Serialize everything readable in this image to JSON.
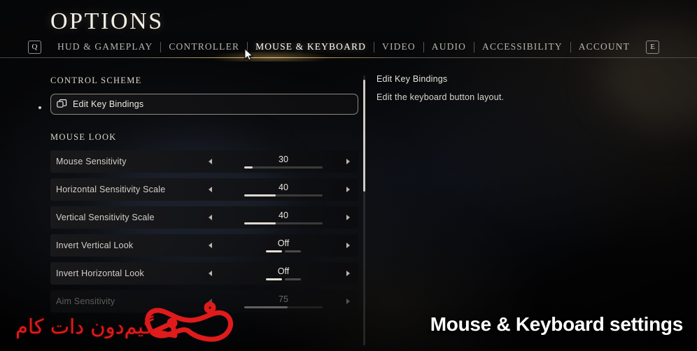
{
  "header": {
    "title": "OPTIONS",
    "left_key_hint": "Q",
    "right_key_hint": "E",
    "tabs": [
      {
        "label": "HUD & GAMEPLAY",
        "active": false
      },
      {
        "label": "CONTROLLER",
        "active": false
      },
      {
        "label": "MOUSE & KEYBOARD",
        "active": true
      },
      {
        "label": "VIDEO",
        "active": false
      },
      {
        "label": "AUDIO",
        "active": false
      },
      {
        "label": "ACCESSIBILITY",
        "active": false
      },
      {
        "label": "ACCOUNT",
        "active": false
      }
    ]
  },
  "sections": [
    {
      "heading": "CONTROL SCHEME",
      "rows": [
        {
          "label": "Edit Key Bindings",
          "type": "action",
          "icon": "key-bindings-icon",
          "selected": true
        }
      ]
    },
    {
      "heading": "MOUSE LOOK",
      "rows": [
        {
          "label": "Mouse Sensitivity",
          "type": "slider",
          "value": "30",
          "fill_percent": 11
        },
        {
          "label": "Horizontal Sensitivity Scale",
          "type": "slider",
          "value": "40",
          "fill_percent": 40
        },
        {
          "label": "Vertical Sensitivity Scale",
          "type": "slider",
          "value": "40",
          "fill_percent": 40
        },
        {
          "label": "Invert Vertical Look",
          "type": "toggle",
          "value": "Off",
          "on_index": 0
        },
        {
          "label": "Invert Horizontal Look",
          "type": "toggle",
          "value": "Off",
          "on_index": 0
        },
        {
          "label": "Aim Sensitivity",
          "type": "slider",
          "value": "75",
          "fill_percent": 55,
          "faded": true
        }
      ]
    }
  ],
  "description": {
    "title": "Edit Key Bindings",
    "body": "Edit the keyboard button layout."
  },
  "overlay": {
    "caption": "Mouse & Keyboard settings",
    "watermark_text": "گیم‌دون دات کام",
    "watermark_color": "#e01b1b"
  },
  "colors": {
    "accent": "#e7ba68",
    "text_primary": "#eceae4",
    "text_secondary": "#b9b5ad",
    "row_background": "#1a1a1c",
    "slider_fill": "#ddd9d0"
  }
}
